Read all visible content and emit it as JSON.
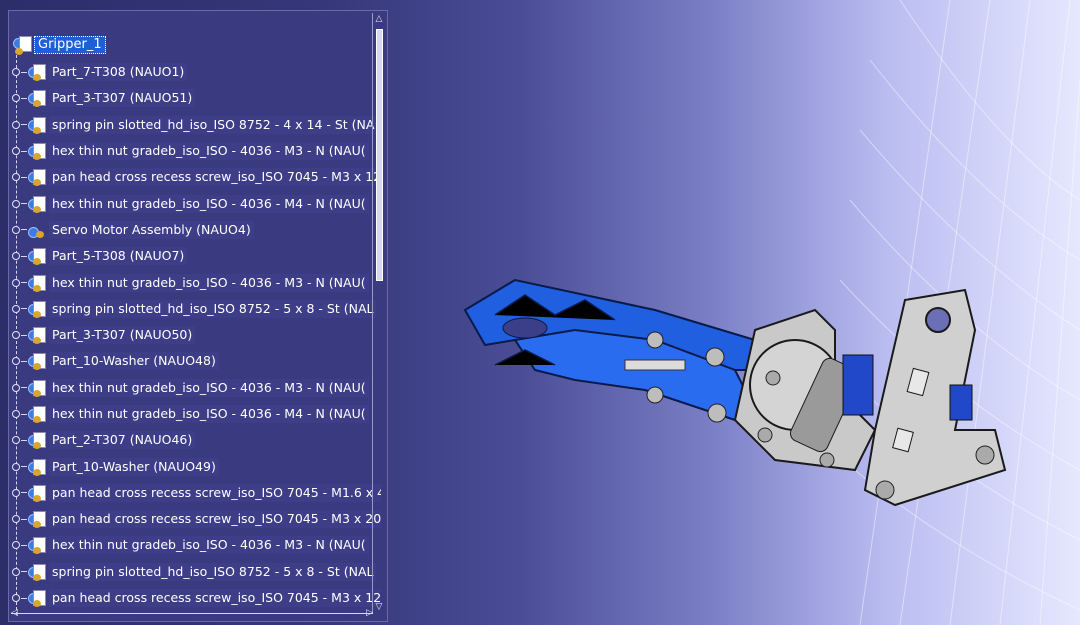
{
  "tree": {
    "root": "Gripper_1",
    "items": [
      {
        "label": "Part_7-T308 (NAUO1)"
      },
      {
        "label": "Part_3-T307 (NAUO51)"
      },
      {
        "label": "spring pin slotted_hd_iso_ISO 8752 - 4 x 14 - St (NA"
      },
      {
        "label": "hex thin nut gradeb_iso_ISO - 4036 - M3 - N (NAU("
      },
      {
        "label": "pan head cross recess screw_iso_ISO 7045 - M3 x 12"
      },
      {
        "label": "hex thin nut gradeb_iso_ISO - 4036 - M4 - N (NAU("
      },
      {
        "label": "Servo Motor Assembly (NAUO4)"
      },
      {
        "label": "Part_5-T308 (NAUO7)"
      },
      {
        "label": "hex thin nut gradeb_iso_ISO - 4036 - M3 - N (NAU("
      },
      {
        "label": "spring pin slotted_hd_iso_ISO 8752 - 5 x 8 - St (NAL"
      },
      {
        "label": "Part_3-T307 (NAUO50)"
      },
      {
        "label": "Part_10-Washer (NAUO48)"
      },
      {
        "label": "hex thin nut gradeb_iso_ISO - 4036 - M3 - N (NAU("
      },
      {
        "label": "hex thin nut gradeb_iso_ISO - 4036 - M4 - N (NAU("
      },
      {
        "label": "Part_2-T307 (NAUO46)"
      },
      {
        "label": "Part_10-Washer (NAUO49)"
      },
      {
        "label": "pan head cross recess screw_iso_ISO 7045 - M1.6 x 4"
      },
      {
        "label": "pan head cross recess screw_iso_ISO 7045 - M3 x 20"
      },
      {
        "label": "hex thin nut gradeb_iso_ISO - 4036 - M3 - N (NAU("
      },
      {
        "label": "spring pin slotted_hd_iso_ISO 8752 - 5 x 8 - St (NAL"
      },
      {
        "label": "pan head cross recess screw_iso_ISO 7045 - M3 x 12"
      }
    ]
  },
  "colors": {
    "panel_bg": "#3a3a80",
    "selection": "#1d5fd6",
    "gripper_blue": "#1f5fe0",
    "metal_gray": "#c9c9c9"
  },
  "icons": {
    "part": "part-icon",
    "assembly": "assembly-icon"
  }
}
